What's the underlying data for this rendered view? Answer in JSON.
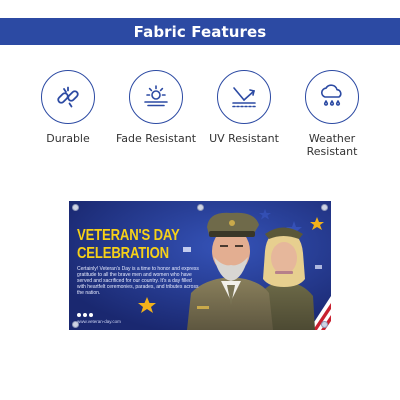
{
  "header": {
    "title": "Fabric Features"
  },
  "features": [
    {
      "label": "Durable",
      "icon": "chain-link-icon"
    },
    {
      "label": "Fade Resistant",
      "icon": "sun-icon"
    },
    {
      "label": "UV Resistant",
      "icon": "uv-ray-icon"
    },
    {
      "label": "Weather Resistant",
      "icon": "cloud-rain-icon"
    }
  ],
  "banner": {
    "title_line1": "VETERAN'S DAY",
    "title_line2": "CELEBRATION",
    "body": "Certainly! Veteran's Day is a time to honor and express gratitude to all the brave men and women who have served and sacrificed for our country. It's a day filled with heartfelt ceremonies, parades, and tributes across the nation.",
    "url": "www.veteran-day.com"
  },
  "colors": {
    "brand_blue": "#2c4aa3",
    "banner_navy": "#1f2f82",
    "title_yellow": "#f7d117",
    "star_gold": "#f2b21b"
  }
}
